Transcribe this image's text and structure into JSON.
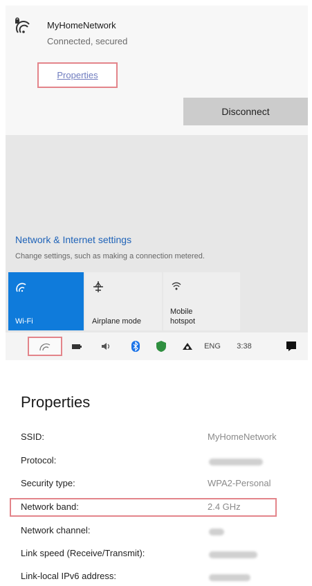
{
  "flyout": {
    "network_name": "MyHomeNetwork",
    "network_status": "Connected, secured",
    "properties_link": "Properties",
    "disconnect_button": "Disconnect",
    "settings_link": "Network & Internet settings",
    "settings_sub": "Change settings, such as making a connection metered.",
    "tiles": {
      "wifi": "Wi-Fi",
      "airplane": "Airplane mode",
      "hotspot_line1": "Mobile",
      "hotspot_line2": "hotspot"
    },
    "taskbar": {
      "language": "ENG",
      "time": "3:38"
    }
  },
  "properties": {
    "title": "Properties",
    "rows": [
      {
        "label": "SSID:",
        "value": "MyHomeNetwork"
      },
      {
        "label": "Protocol:",
        "value": ""
      },
      {
        "label": "Security type:",
        "value": "WPA2-Personal"
      },
      {
        "label": "Network band:",
        "value": "2.4 GHz"
      },
      {
        "label": "Network channel:",
        "value": ""
      },
      {
        "label": "Link speed (Receive/Transmit):",
        "value": ""
      },
      {
        "label": "Link-local IPv6 address:",
        "value": ""
      }
    ]
  },
  "colors": {
    "accent": "#0f7bdb",
    "highlight_border": "#e3848a",
    "link": "#1f63b8"
  }
}
